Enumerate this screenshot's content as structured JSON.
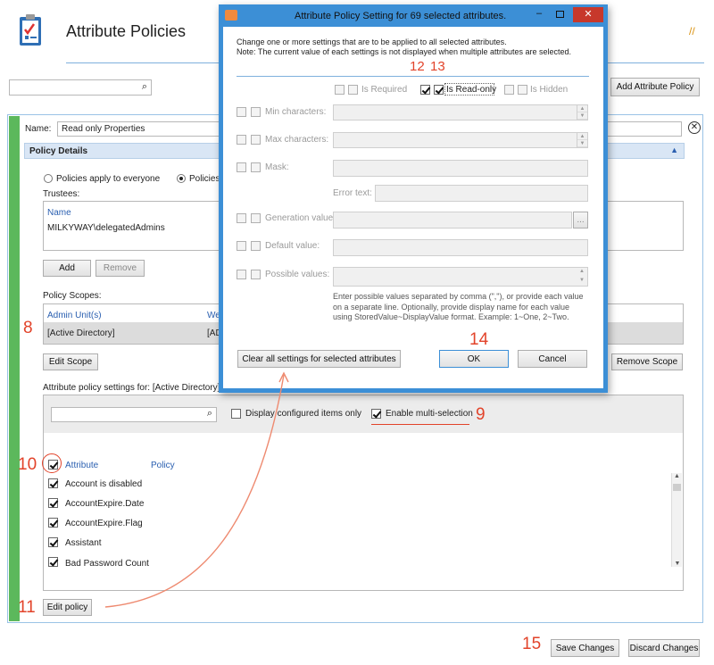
{
  "page": {
    "title": "Attribute Policies",
    "search_value": "",
    "add_policy_label": "Add Attribute Policy",
    "name_label": "Name:",
    "name_value": "Read only Properties",
    "policy_details_label": "Policy Details",
    "radio_everyone": "Policies apply to everyone",
    "radio_selected": "Policies",
    "trustees_label": "Trustees:",
    "trustees_header": "Name",
    "trustee_row": "MILKYWAY\\delegatedAdmins",
    "add_label": "Add",
    "remove_label": "Remove",
    "policy_scopes_label": "Policy Scopes:",
    "scopes_col1": "Admin Unit(s)",
    "scopes_col2": "We",
    "scope_row_col1": "[Active Directory]",
    "scope_row_col2": "[AD",
    "edit_scope_label": "Edit Scope",
    "remove_scope_label": "Remove Scope",
    "settings_for_label": "Attribute policy settings for: [Active Directory]",
    "display_configured_label": "Display configured items only",
    "enable_multi_label": "Enable multi-selection",
    "attr_col_header": "Attribute",
    "policy_col_header": "Policy",
    "attributes": [
      "Account is disabled",
      "AccountExpire.Date",
      "AccountExpire.Flag",
      "Assistant",
      "Bad Password Count"
    ],
    "edit_policy_label": "Edit policy",
    "save_label": "Save Changes",
    "discard_label": "Discard Changes"
  },
  "dialog": {
    "title": "Attribute Policy Setting for 69 selected attributes.",
    "note_line1": "Change one or more settings that are to be applied to all selected attributes.",
    "note_line2": "Note: The current value of each settings is not displayed when multiple attributes are selected.",
    "is_required": "Is Required",
    "is_readonly": "Is Read-only",
    "is_hidden": "Is Hidden",
    "min_chars": "Min characters:",
    "max_chars": "Max characters:",
    "mask": "Mask:",
    "error_text": "Error text:",
    "generation_value": "Generation value:",
    "ellipsis": "...",
    "default_value": "Default value:",
    "possible_values": "Possible values:",
    "help_text": "Enter possible values separated by comma (\",\"), or provide each value on a separate line. Optionally, provide display name for each value using StoredValue~DisplayValue format. Example: 1~One, 2~Two.",
    "clear_label": "Clear all settings for selected attributes",
    "ok_label": "OK",
    "cancel_label": "Cancel"
  },
  "annotations": {
    "a8": "8",
    "a9": "9",
    "a10": "10",
    "a11": "11",
    "a12": "12",
    "a13": "13",
    "a14": "14",
    "a15": "15"
  },
  "colors": {
    "accent_green": "#5cb85c",
    "dialog_border": "#3c8fd6",
    "annotation": "#e2432a",
    "section_header": "#d9e6f5"
  }
}
